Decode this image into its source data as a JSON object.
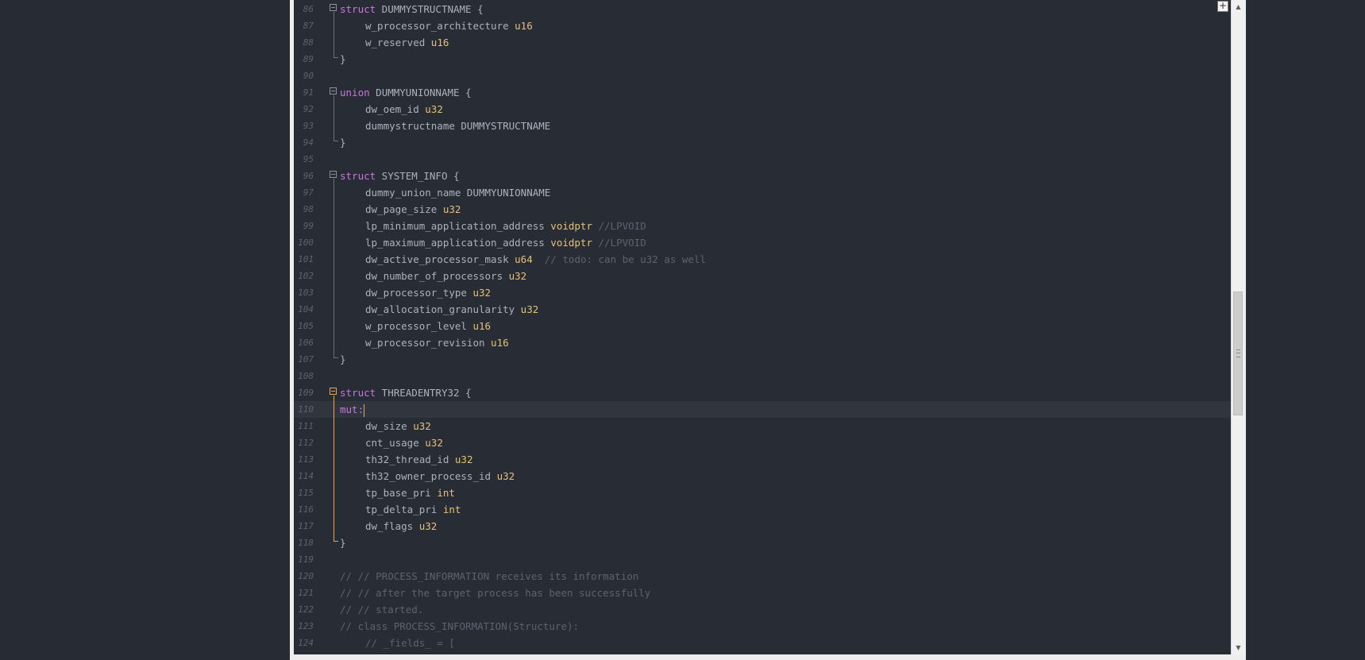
{
  "editor": {
    "lines": [
      {
        "n": "86",
        "tokens": [
          {
            "t": "struct",
            "c": "kw"
          },
          {
            "t": " DUMMYSTRUCTNAME {",
            "c": "ident"
          }
        ]
      },
      {
        "n": "87",
        "indent": true,
        "tokens": [
          {
            "t": "w_processor_architecture ",
            "c": "ident"
          },
          {
            "t": "u16",
            "c": "ty"
          }
        ]
      },
      {
        "n": "88",
        "indent": true,
        "tokens": [
          {
            "t": "w_reserved ",
            "c": "ident"
          },
          {
            "t": "u16",
            "c": "ty"
          }
        ]
      },
      {
        "n": "89",
        "tokens": [
          {
            "t": "}",
            "c": "ident"
          }
        ]
      },
      {
        "n": "90",
        "tokens": []
      },
      {
        "n": "91",
        "tokens": [
          {
            "t": "union",
            "c": "kw"
          },
          {
            "t": " DUMMYUNIONNAME {",
            "c": "ident"
          }
        ]
      },
      {
        "n": "92",
        "indent": true,
        "tokens": [
          {
            "t": "dw_oem_id ",
            "c": "ident"
          },
          {
            "t": "u32",
            "c": "ty"
          }
        ]
      },
      {
        "n": "93",
        "indent": true,
        "tokens": [
          {
            "t": "dummystructname DUMMYSTRUCTNAME",
            "c": "ident"
          }
        ]
      },
      {
        "n": "94",
        "tokens": [
          {
            "t": "}",
            "c": "ident"
          }
        ]
      },
      {
        "n": "95",
        "tokens": []
      },
      {
        "n": "96",
        "tokens": [
          {
            "t": "struct",
            "c": "kw"
          },
          {
            "t": " SYSTEM_INFO {",
            "c": "ident"
          }
        ]
      },
      {
        "n": "97",
        "indent": true,
        "tokens": [
          {
            "t": "dummy_union_name DUMMYUNIONNAME",
            "c": "ident"
          }
        ]
      },
      {
        "n": "98",
        "indent": true,
        "tokens": [
          {
            "t": "dw_page_size ",
            "c": "ident"
          },
          {
            "t": "u32",
            "c": "ty"
          }
        ]
      },
      {
        "n": "99",
        "indent": true,
        "tokens": [
          {
            "t": "lp_minimum_application_address ",
            "c": "ident"
          },
          {
            "t": "voidptr",
            "c": "ty"
          },
          {
            "t": " //LPVOID",
            "c": "cm"
          }
        ]
      },
      {
        "n": "100",
        "indent": true,
        "tokens": [
          {
            "t": "lp_maximum_application_address ",
            "c": "ident"
          },
          {
            "t": "voidptr",
            "c": "ty"
          },
          {
            "t": " //LPVOID",
            "c": "cm"
          }
        ]
      },
      {
        "n": "101",
        "indent": true,
        "tokens": [
          {
            "t": "dw_active_processor_mask ",
            "c": "ident"
          },
          {
            "t": "u64",
            "c": "ty"
          },
          {
            "t": "  // todo: can be u32 as well",
            "c": "cm"
          }
        ]
      },
      {
        "n": "102",
        "indent": true,
        "tokens": [
          {
            "t": "dw_number_of_processors ",
            "c": "ident"
          },
          {
            "t": "u32",
            "c": "ty"
          }
        ]
      },
      {
        "n": "103",
        "indent": true,
        "tokens": [
          {
            "t": "dw_processor_type ",
            "c": "ident"
          },
          {
            "t": "u32",
            "c": "ty"
          }
        ]
      },
      {
        "n": "104",
        "indent": true,
        "tokens": [
          {
            "t": "dw_allocation_granularity ",
            "c": "ident"
          },
          {
            "t": "u32",
            "c": "ty"
          }
        ]
      },
      {
        "n": "105",
        "indent": true,
        "tokens": [
          {
            "t": "w_processor_level ",
            "c": "ident"
          },
          {
            "t": "u16",
            "c": "ty"
          }
        ]
      },
      {
        "n": "106",
        "indent": true,
        "tokens": [
          {
            "t": "w_processor_revision ",
            "c": "ident"
          },
          {
            "t": "u16",
            "c": "ty"
          }
        ]
      },
      {
        "n": "107",
        "tokens": [
          {
            "t": "}",
            "c": "ident"
          }
        ]
      },
      {
        "n": "108",
        "tokens": []
      },
      {
        "n": "109",
        "tokens": [
          {
            "t": "struct",
            "c": "kw"
          },
          {
            "t": " THREADENTRY32 {",
            "c": "ident"
          }
        ]
      },
      {
        "n": "110",
        "current": true,
        "tokens": [
          {
            "t": "mut:",
            "c": "kw"
          }
        ]
      },
      {
        "n": "111",
        "indent": true,
        "tokens": [
          {
            "t": "dw_size ",
            "c": "ident"
          },
          {
            "t": "u32",
            "c": "ty"
          }
        ]
      },
      {
        "n": "112",
        "indent": true,
        "tokens": [
          {
            "t": "cnt_usage ",
            "c": "ident"
          },
          {
            "t": "u32",
            "c": "ty"
          }
        ]
      },
      {
        "n": "113",
        "indent": true,
        "tokens": [
          {
            "t": "th32_thread_id ",
            "c": "ident"
          },
          {
            "t": "u32",
            "c": "ty"
          }
        ]
      },
      {
        "n": "114",
        "indent": true,
        "tokens": [
          {
            "t": "th32_owner_process_id ",
            "c": "ident"
          },
          {
            "t": "u32",
            "c": "ty"
          }
        ]
      },
      {
        "n": "115",
        "indent": true,
        "tokens": [
          {
            "t": "tp_base_pri ",
            "c": "ident"
          },
          {
            "t": "int",
            "c": "ty"
          }
        ]
      },
      {
        "n": "116",
        "indent": true,
        "tokens": [
          {
            "t": "tp_delta_pri ",
            "c": "ident"
          },
          {
            "t": "int",
            "c": "ty"
          }
        ]
      },
      {
        "n": "117",
        "indent": true,
        "tokens": [
          {
            "t": "dw_flags ",
            "c": "ident"
          },
          {
            "t": "u32",
            "c": "ty"
          }
        ]
      },
      {
        "n": "118",
        "tokens": [
          {
            "t": "}",
            "c": "ident"
          }
        ]
      },
      {
        "n": "119",
        "tokens": []
      },
      {
        "n": "120",
        "tokens": [
          {
            "t": "// // PROCESS_INFORMATION receives its information",
            "c": "cm"
          }
        ]
      },
      {
        "n": "121",
        "tokens": [
          {
            "t": "// // after the target process has been successfully",
            "c": "cm"
          }
        ]
      },
      {
        "n": "122",
        "tokens": [
          {
            "t": "// // started.",
            "c": "cm"
          }
        ]
      },
      {
        "n": "123",
        "tokens": [
          {
            "t": "// class PROCESS_INFORMATION(Structure):",
            "c": "cm"
          }
        ]
      },
      {
        "n": "124",
        "indent": true,
        "tokens": [
          {
            "t": "// _fields_ = [",
            "c": "cm"
          }
        ]
      }
    ]
  },
  "scrollbar": {
    "up_icon": "triangle-up-icon",
    "down_icon": "triangle-down-icon",
    "up_glyph": "▲",
    "down_glyph": "▼",
    "position_fraction": 0.45
  },
  "split_button": {
    "icon": "plus-icon",
    "glyph": "+"
  },
  "colors": {
    "background": "#282c34",
    "keyword": "#c678dd",
    "type": "#e5c07b",
    "comment": "#5c6370",
    "identifier": "#abb2bf",
    "fold_active": "#e5a55b"
  }
}
